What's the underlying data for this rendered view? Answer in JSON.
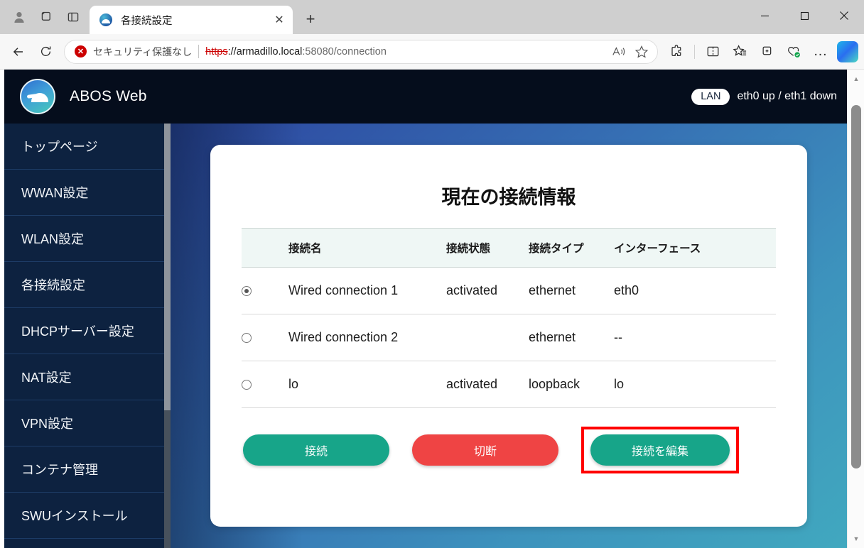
{
  "browser": {
    "tab": {
      "title": "各接続設定",
      "favicon": "armadillo-favicon",
      "close": "✕"
    },
    "newtab_label": "+",
    "window_controls": {
      "minimize": "—",
      "maximize": "▢",
      "close": "✕"
    },
    "toolbar": {
      "back": "←",
      "refresh": "⟳",
      "security_label": "セキュリティ保護なし",
      "url_scheme": "https",
      "url_rest": "://armadillo.local:58080/connection",
      "url_host": "armadillo.local",
      "url_port_path": ":58080/connection",
      "read_aloud": "A",
      "favorite": "☆",
      "extensions": "extensions-icon",
      "split_screen": "split-screen-icon",
      "collections_favorites": "favorites-list-icon",
      "add_collection": "collections-icon",
      "browser_essentials": "browser-essentials-icon",
      "settings_more": "…",
      "copilot": "copilot-icon"
    }
  },
  "app": {
    "brand": "ABOS Web",
    "lan_badge": "LAN",
    "net_status": "eth0 up / eth1 down"
  },
  "sidebar": {
    "items": [
      {
        "label": "トップページ"
      },
      {
        "label": "WWAN設定"
      },
      {
        "label": "WLAN設定"
      },
      {
        "label": "各接続設定"
      },
      {
        "label": "DHCPサーバー設定"
      },
      {
        "label": "NAT設定"
      },
      {
        "label": "VPN設定"
      },
      {
        "label": "コンテナ管理"
      },
      {
        "label": "SWUインストール"
      }
    ]
  },
  "main": {
    "title": "現在の接続情報",
    "table": {
      "headers": [
        "",
        "接続名",
        "接続状態",
        "接続タイプ",
        "インターフェース"
      ],
      "rows": [
        {
          "selected": true,
          "name": "Wired connection 1",
          "state": "activated",
          "type": "ethernet",
          "interface": "eth0"
        },
        {
          "selected": false,
          "name": "Wired connection 2",
          "state": "",
          "type": "ethernet",
          "interface": "--"
        },
        {
          "selected": false,
          "name": "lo",
          "state": "activated",
          "type": "loopback",
          "interface": "lo"
        }
      ]
    },
    "buttons": {
      "connect": "接続",
      "disconnect": "切断",
      "edit": "接続を編集"
    }
  },
  "colors": {
    "teal": "#17a589",
    "red": "#ef4444",
    "highlight": "#ff0000",
    "sidebar": "#0d2240",
    "header": "#050d1c"
  }
}
